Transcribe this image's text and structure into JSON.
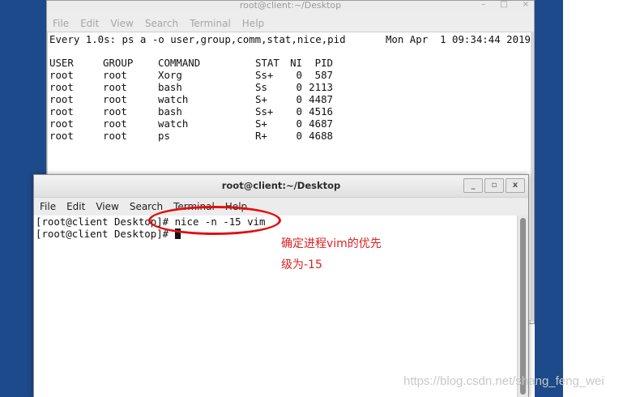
{
  "back_window": {
    "title": "root@client:~/Desktop",
    "menu": [
      "File",
      "Edit",
      "View",
      "Search",
      "Terminal",
      "Help"
    ],
    "watch_command": "Every 1.0s: ps a -o user,group,comm,stat,nice,pid",
    "watch_time": "Mon Apr  1 09:34:44 2019",
    "ps_headers": [
      "USER",
      "GROUP",
      "COMMAND",
      "STAT",
      "NI",
      "PID"
    ],
    "ps_rows": [
      [
        "root",
        "root",
        "Xorg",
        "Ss+",
        "0",
        "587"
      ],
      [
        "root",
        "root",
        "bash",
        "Ss",
        "0",
        "2113"
      ],
      [
        "root",
        "root",
        "watch",
        "S+",
        "0",
        "4487"
      ],
      [
        "root",
        "root",
        "bash",
        "Ss+",
        "0",
        "4516"
      ],
      [
        "root",
        "root",
        "watch",
        "S+",
        "0",
        "4687"
      ],
      [
        "root",
        "root",
        "ps",
        "R+",
        "0",
        "4688"
      ]
    ]
  },
  "front_window": {
    "title": "root@client:~/Desktop",
    "controls": [
      "_",
      "▫",
      "x"
    ],
    "menu": [
      "File",
      "Edit",
      "View",
      "Search",
      "Terminal",
      "Help"
    ],
    "lines": [
      "[root@client Desktop]# nice -n -15 vim",
      "[root@client Desktop]# "
    ]
  },
  "annotation": {
    "line1": "确定进程vim的优先",
    "line2": "级为-15",
    "color": "#e02020"
  },
  "watermark": "https://blog.csdn.net/shang_feng_wei",
  "colors": {
    "desktop": "#1d4a8a"
  }
}
